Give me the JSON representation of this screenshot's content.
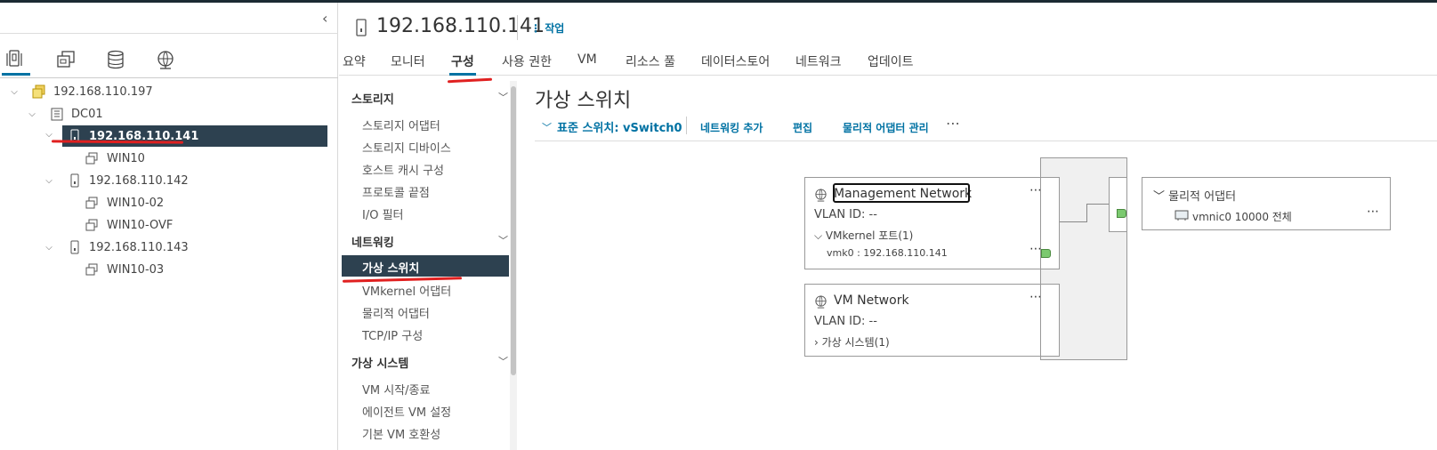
{
  "nav": {
    "icons": [
      "hosts-clusters-icon",
      "vms-templates-icon",
      "storage-icon",
      "networking-icon"
    ]
  },
  "tree": {
    "vcenter": "192.168.110.197",
    "datacenter": "DC01",
    "host1": "192.168.110.141",
    "host1_vm": "WIN10",
    "host2": "192.168.110.142",
    "host2_vm1": "WIN10-02",
    "host2_vm2": "WIN10-OVF",
    "host3": "192.168.110.143",
    "host3_vm": "WIN10-03"
  },
  "header": {
    "title": "192.168.110.141",
    "actions_label": "작업"
  },
  "tabs": [
    "요약",
    "모니터",
    "구성",
    "사용 권한",
    "VM",
    "리소스 풀",
    "데이터스토어",
    "네트워크",
    "업데이트"
  ],
  "config_menu": {
    "storage": "스토리지",
    "storage_items": [
      "스토리지 어댑터",
      "스토리지 디바이스",
      "호스트 캐시 구성",
      "프로토콜 끝점",
      "I/O 필터"
    ],
    "networking": "네트워킹",
    "networking_items": [
      "가상 스위치",
      "VMkernel 어댑터",
      "물리적 어댑터",
      "TCP/IP 구성"
    ],
    "vms": "가상 시스템",
    "vm_items": [
      "VM 시작/종료",
      "에이전트 VM 설정",
      "기본 VM 호환성"
    ]
  },
  "content": {
    "title": "가상 스위치",
    "switch_label": "표준 스위치: vSwitch0",
    "add_networking": "네트워킹 추가",
    "edit": "편집",
    "manage_physical": "물리적 어댑터 관리",
    "more": "⋯"
  },
  "mgmt_pg": {
    "name": "Management Network",
    "vlan": "VLAN ID: --",
    "vmk_ports": "VMkernel 포트(1)",
    "vmk0": "vmk0 : 192.168.110.141"
  },
  "vm_pg": {
    "name": "VM Network",
    "vlan": "VLAN ID: --",
    "vms": "가상 시스템(1)"
  },
  "physical": {
    "title": "물리적 어댑터",
    "vmnic": "vmnic0 10000 전체"
  }
}
